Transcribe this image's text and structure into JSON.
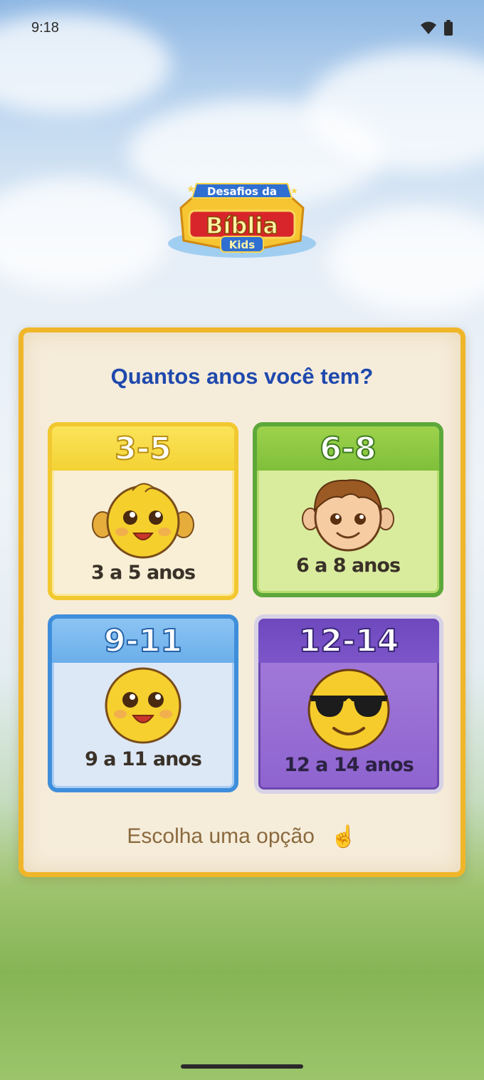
{
  "status": {
    "time": "9:18"
  },
  "app": {
    "logo": {
      "line1": "Desafios da",
      "line2": "Bíblia",
      "line3": "Kids"
    }
  },
  "panel": {
    "question": "Quantos anos você tem?",
    "hint": "Escolha uma opção",
    "options": [
      {
        "range": "3-5",
        "label": "3 a 5 anos",
        "icon": "baby-face-icon"
      },
      {
        "range": "6-8",
        "label": "6 a 8 anos",
        "icon": "boy-face-icon"
      },
      {
        "range": "9-11",
        "label": "9 a 11 anos",
        "icon": "smiling-face-icon"
      },
      {
        "range": "12-14",
        "label": "12 a 14 anos",
        "icon": "sunglasses-face-icon"
      }
    ]
  }
}
